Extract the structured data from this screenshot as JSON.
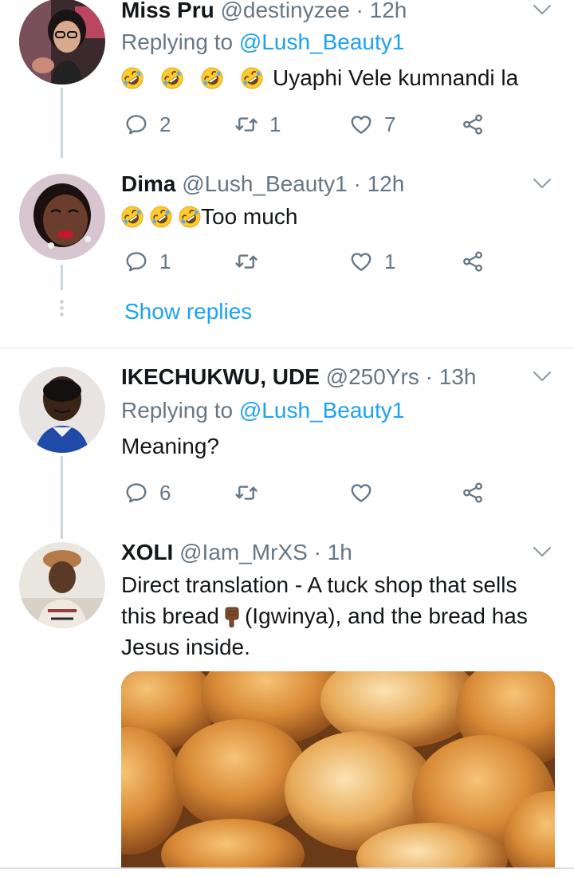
{
  "tweets": [
    {
      "name": "Miss Pru",
      "handle": "@destinyzee · 12h",
      "replying_label": "Replying to",
      "replying_handle": "@Lush_Beauty1",
      "text": "Uyaphi Vele kumnandi la",
      "emoji": "rolling-on-floor-laughing",
      "reply_count": "2",
      "retweet_count": "1",
      "like_count": "7"
    },
    {
      "name": "Dima",
      "handle": "@Lush_Beauty1 · 12h",
      "text": "Too much",
      "emoji": "rolling-on-floor-laughing",
      "reply_count": "1",
      "retweet_count": "",
      "like_count": "1"
    },
    {
      "name": "IKECHUKWU, UDE",
      "handle": "@250Yrs · 13h",
      "replying_label": "Replying to",
      "replying_handle": "@Lush_Beauty1",
      "text": "Meaning?",
      "reply_count": "6",
      "retweet_count": "",
      "like_count": ""
    },
    {
      "name": "XOLI",
      "handle": "@Iam_MrXS · 1h",
      "text_line1": "Direct translation - A tuck shop that sells",
      "text_line2_a": "this bread",
      "text_line2_b": "(Igwinya), and the bread has",
      "text_line3": "Jesus inside.",
      "emoji": "backhand-index-pointing-down-dark-skin",
      "image": "fried-dough-buns-photo"
    }
  ],
  "show_replies": "Show replies",
  "icons": {
    "reply": "reply-icon",
    "retweet": "retweet-icon",
    "like": "heart-icon",
    "share": "share-icon",
    "caret": "chevron-down-icon"
  },
  "colors": {
    "link": "#1da1f2",
    "secondary": "#657786",
    "text": "#14171a",
    "thread_line": "#ccd6dd"
  }
}
